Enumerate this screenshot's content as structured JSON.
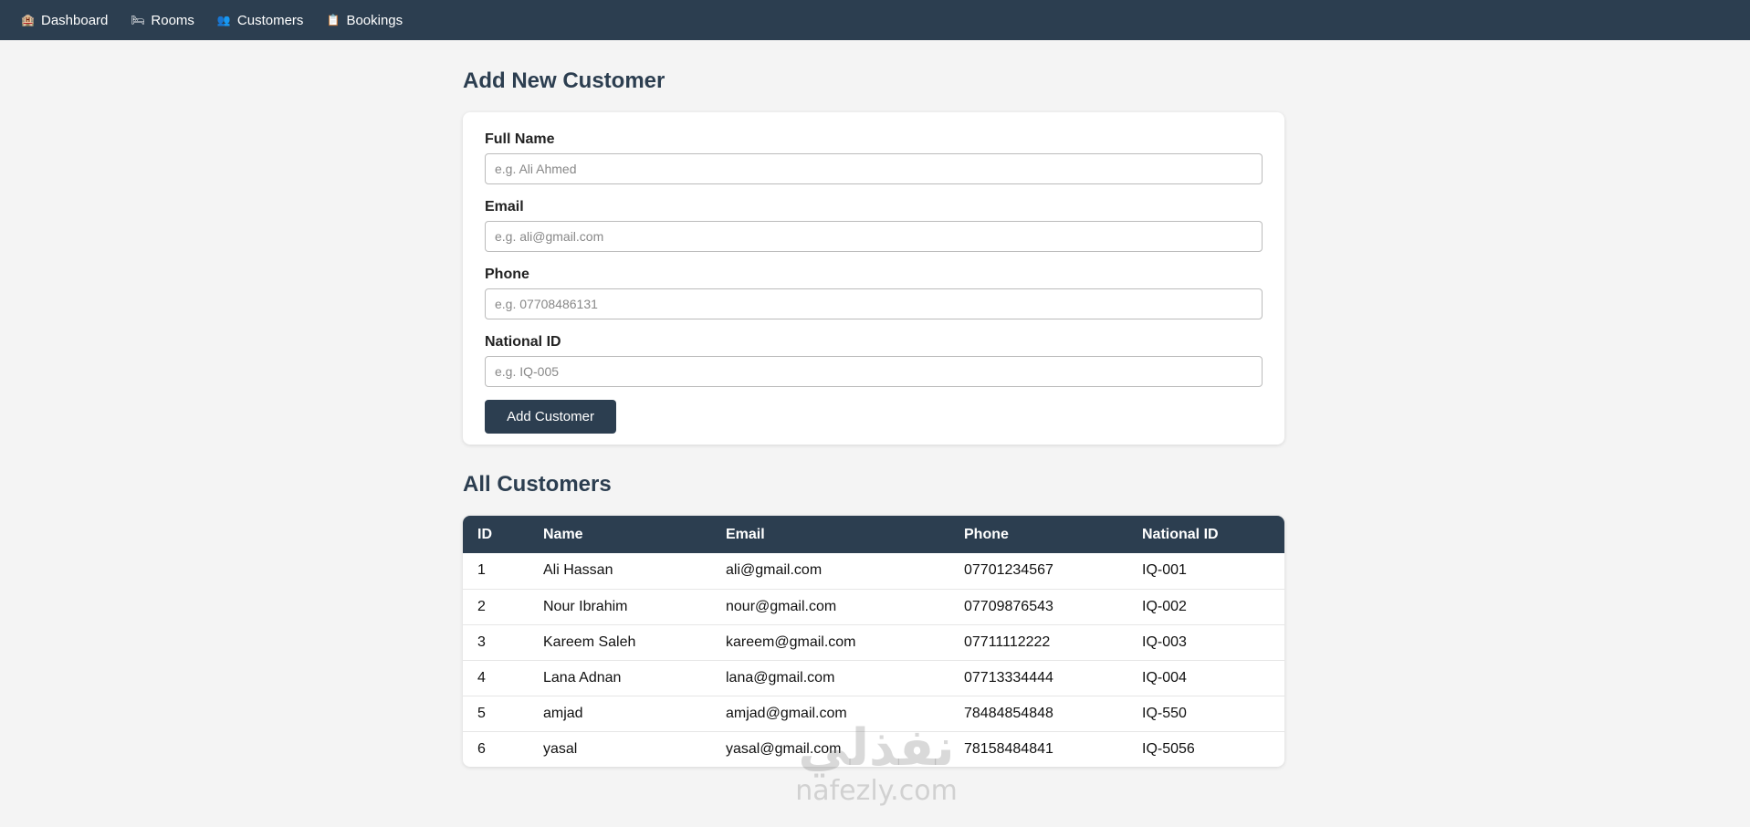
{
  "nav": {
    "items": [
      {
        "label": "Dashboard",
        "icon": "hotel-icon",
        "glyph": "🏨"
      },
      {
        "label": "Rooms",
        "icon": "bed-icon",
        "glyph": "🛏"
      },
      {
        "label": "Customers",
        "icon": "users-icon",
        "glyph": "👥"
      },
      {
        "label": "Bookings",
        "icon": "clipboard-icon",
        "glyph": "📋"
      }
    ]
  },
  "form": {
    "title": "Add New Customer",
    "full_name": {
      "label": "Full Name",
      "placeholder": "e.g. Ali Ahmed",
      "value": ""
    },
    "email": {
      "label": "Email",
      "placeholder": "e.g. ali@gmail.com",
      "value": ""
    },
    "phone": {
      "label": "Phone",
      "placeholder": "e.g. 07708486131",
      "value": ""
    },
    "national_id": {
      "label": "National ID",
      "placeholder": "e.g. IQ-005",
      "value": ""
    },
    "submit_label": "Add Customer"
  },
  "customers": {
    "title": "All Customers",
    "columns": [
      "ID",
      "Name",
      "Email",
      "Phone",
      "National ID"
    ],
    "rows": [
      [
        "1",
        "Ali Hassan",
        "ali@gmail.com",
        "07701234567",
        "IQ-001"
      ],
      [
        "2",
        "Nour Ibrahim",
        "nour@gmail.com",
        "07709876543",
        "IQ-002"
      ],
      [
        "3",
        "Kareem Saleh",
        "kareem@gmail.com",
        "07711112222",
        "IQ-003"
      ],
      [
        "4",
        "Lana Adnan",
        "lana@gmail.com",
        "07713334444",
        "IQ-004"
      ],
      [
        "5",
        "amjad",
        "amjad@gmail.com",
        "78484854848",
        "IQ-550"
      ],
      [
        "6",
        "yasal",
        "yasal@gmail.com",
        "78158484841",
        "IQ-5056"
      ]
    ]
  },
  "watermark": {
    "arabic": "نفذلي",
    "latin": "nafezly.com"
  },
  "colors": {
    "navbar": "#2c3e50",
    "background": "#f4f4f4",
    "button": "#2c3e50"
  }
}
